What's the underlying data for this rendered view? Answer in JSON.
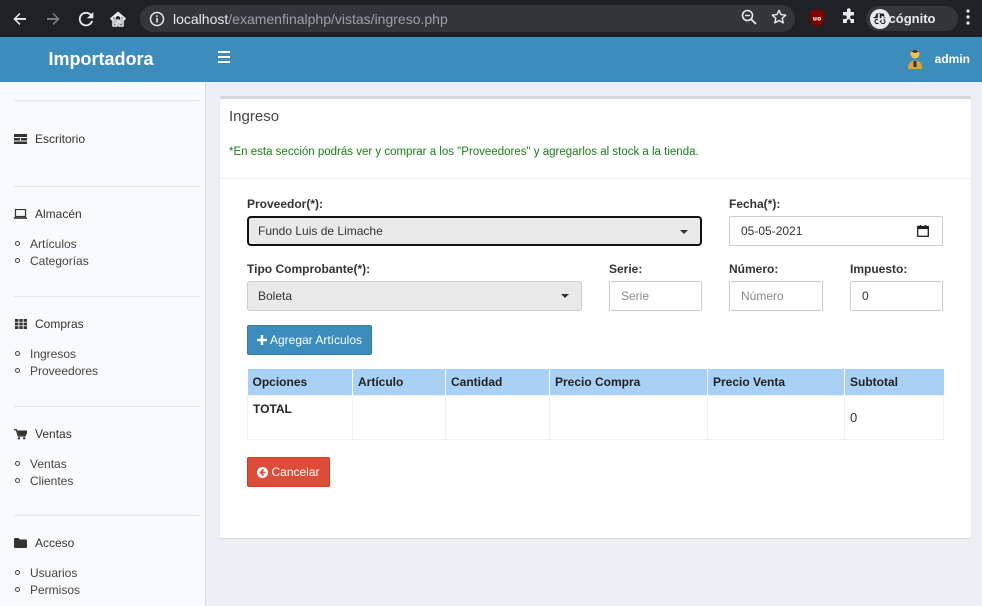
{
  "browser": {
    "url_host": "localhost",
    "url_path": "/examenfinalphp/vistas/ingreso.php",
    "incognito_label": "Incógnito",
    "extension_badge": "uo"
  },
  "header": {
    "app_title": "Importadora",
    "user_name": "admin"
  },
  "sidebar": {
    "sections": [
      {
        "label": "Escritorio",
        "icon": "dashboard-icon",
        "items": []
      },
      {
        "label": "Almacén",
        "icon": "laptop-icon",
        "items": [
          "Artículos",
          "Categorías"
        ]
      },
      {
        "label": "Compras",
        "icon": "grid-icon",
        "items": [
          "Ingresos",
          "Proveedores"
        ]
      },
      {
        "label": "Ventas",
        "icon": "cart-icon",
        "items": [
          "Ventas",
          "Clientes"
        ]
      },
      {
        "label": "Acceso",
        "icon": "folder-icon",
        "items": [
          "Usuarios",
          "Permisos"
        ]
      }
    ]
  },
  "panel": {
    "title": "Ingreso",
    "note": "*En esta sección podrás ver y comprar a los \"Proveedores\" y agregarlos al stock a la tienda."
  },
  "form": {
    "proveedor_label": "Proveedor(*):",
    "proveedor_value": "Fundo Luis de Limache",
    "fecha_label": "Fecha(*):",
    "fecha_value": "05-05-2021",
    "tipo_label": "Tipo Comprobante(*):",
    "tipo_value": "Boleta",
    "serie_label": "Serie:",
    "serie_placeholder": "Serie",
    "numero_label": "Número:",
    "numero_placeholder": "Número",
    "impuesto_label": "Impuesto:",
    "impuesto_value": "0",
    "add_button": "Agregar Artículos",
    "cancel_button": "Cancelar"
  },
  "table": {
    "headers": [
      "Opciones",
      "Artículo",
      "Cantidad",
      "Precio Compra",
      "Precio Venta",
      "Subtotal"
    ],
    "total_label": "TOTAL",
    "total_value": "0"
  },
  "colors": {
    "header": "#3c8dbc",
    "table_header": "#a9d0f5",
    "note_text": "#1a7d1a",
    "danger": "#dd4b39"
  }
}
